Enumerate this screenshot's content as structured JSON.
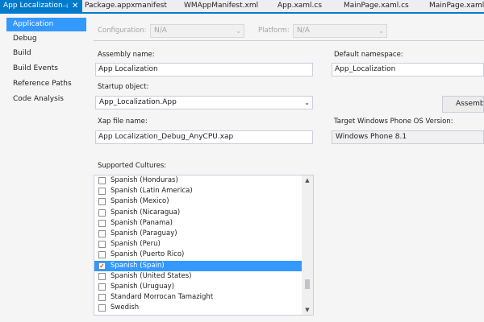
{
  "tabs": [
    {
      "label": "App Localization",
      "active": true
    },
    {
      "label": "Package.appxmanifest"
    },
    {
      "label": "WMAppManifest.xml"
    },
    {
      "label": "App.xaml.cs"
    },
    {
      "label": "MainPage.xaml.cs"
    },
    {
      "label": "MainPage.xaml"
    }
  ],
  "nav": [
    {
      "label": "Application",
      "selected": true
    },
    {
      "label": "Debug"
    },
    {
      "label": "Build"
    },
    {
      "label": "Build Events"
    },
    {
      "label": "Reference Paths"
    },
    {
      "label": "Code Analysis"
    }
  ],
  "config": {
    "configuration_label": "Configuration:",
    "configuration_value": "N/A",
    "platform_label": "Platform:",
    "platform_value": "N/A"
  },
  "form": {
    "assembly_name_label": "Assembly name:",
    "assembly_name_value": "App Localization",
    "default_namespace_label": "Default namespace:",
    "default_namespace_value": "App_Localization",
    "startup_object_label": "Startup object:",
    "startup_object_value": "App_Localization.App",
    "assembly_button_label": "Assembly",
    "xap_label": "Xap file name:",
    "xap_value": "App Localization_Debug_AnyCPU.xap",
    "target_os_label": "Target Windows Phone OS Version:",
    "target_os_value": "Windows Phone 8.1",
    "cultures_label": "Supported Cultures:"
  },
  "cultures": [
    {
      "label": "Spanish (Honduras)",
      "checked": false
    },
    {
      "label": "Spanish (Latin America)",
      "checked": false
    },
    {
      "label": "Spanish (Mexico)",
      "checked": false
    },
    {
      "label": "Spanish (Nicaragua)",
      "checked": false
    },
    {
      "label": "Spanish (Panama)",
      "checked": false
    },
    {
      "label": "Spanish (Paraguay)",
      "checked": false
    },
    {
      "label": "Spanish (Peru)",
      "checked": false
    },
    {
      "label": "Spanish (Puerto Rico)",
      "checked": false
    },
    {
      "label": "Spanish (Spain)",
      "checked": true,
      "selected": true
    },
    {
      "label": "Spanish (United States)",
      "checked": false
    },
    {
      "label": "Spanish (Uruguay)",
      "checked": false
    },
    {
      "label": "Standard Morrocan Tamazight",
      "checked": false
    },
    {
      "label": "Swedish",
      "checked": false
    }
  ],
  "glyphs": {
    "pin": "⊣",
    "close": "✕",
    "dropdown": "⌄",
    "check": "✓",
    "scroll_up": "▲",
    "scroll_down": "▼"
  },
  "colors": {
    "accent": "#007acc",
    "selection": "#3399ff"
  }
}
